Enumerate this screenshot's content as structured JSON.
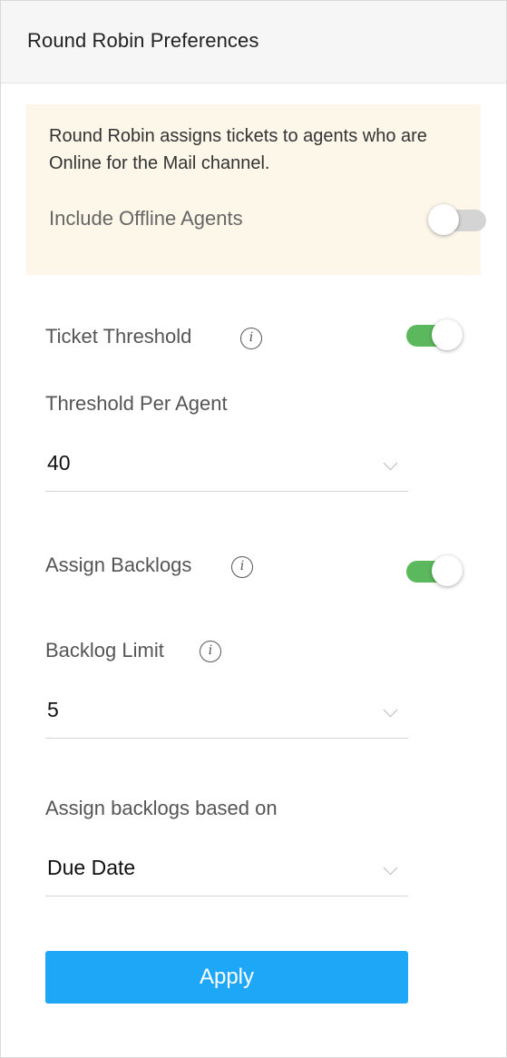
{
  "header": {
    "title": "Round Robin Preferences"
  },
  "info_box": {
    "text": "Round Robin assigns tickets to agents who are Online for the Mail channel.",
    "offline_label": "Include Offline Agents",
    "offline_toggle": "off"
  },
  "ticket_threshold": {
    "label": "Ticket Threshold",
    "info_icon": "i",
    "toggle": "on",
    "per_agent_label": "Threshold Per Agent",
    "per_agent_value": "40"
  },
  "backlogs": {
    "label": "Assign Backlogs",
    "info_icon": "i",
    "toggle": "on",
    "limit_label": "Backlog Limit",
    "limit_info_icon": "i",
    "limit_value": "5",
    "based_on_label": "Assign backlogs based on",
    "based_on_value": "Due Date"
  },
  "apply_label": "Apply",
  "colors": {
    "toggle_on": "#5cb85c",
    "toggle_off": "#d4d4d4",
    "apply_button": "#1ea7f7",
    "info_box_bg": "#fdf7ea"
  }
}
